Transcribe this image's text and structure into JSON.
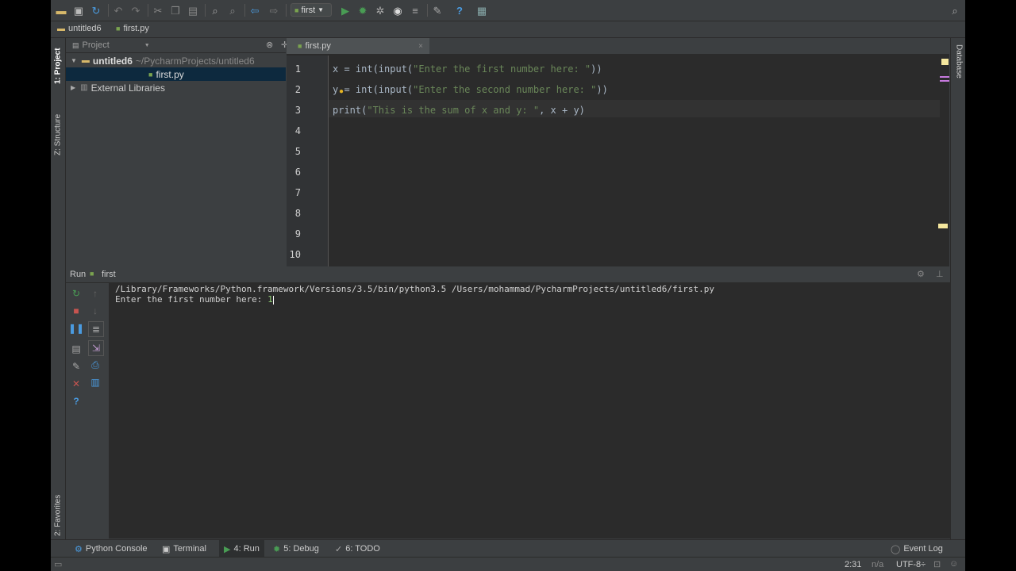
{
  "toolbar": {
    "run_config": "first",
    "icons": [
      "folder-open-icon",
      "save-icon",
      "sync-icon",
      "undo-icon",
      "redo-icon",
      "cut-icon",
      "copy-icon",
      "paste-icon",
      "find-icon",
      "replace-icon",
      "back-icon",
      "forward-icon",
      "run-icon",
      "debug-icon",
      "coverage-icon",
      "stop-icon",
      "vcs-icon",
      "tools-icon",
      "help-icon",
      "sdk-icon",
      "search-icon"
    ]
  },
  "breadcrumb": {
    "project": "untitled6",
    "file": "first.py"
  },
  "left_strip": {
    "project": "1: Project",
    "structure": "Z: Structure",
    "favorites": "2: Favorites"
  },
  "right_strip": {
    "database": "Database"
  },
  "project_panel": {
    "title": "Project",
    "root_name": "untitled6",
    "root_path": "~/PycharmProjects/untitled6",
    "file": "first.py",
    "ext_libs": "External Libraries"
  },
  "editor": {
    "tab_label": "first.py",
    "line_numbers": [
      "1",
      "2",
      "3",
      "4",
      "5",
      "6",
      "7",
      "8",
      "9",
      "10"
    ],
    "lines": [
      {
        "pre": "x = int(input(",
        "str": "\"Enter the first number here: \"",
        "post": "))"
      },
      {
        "pre": "y = int(input(",
        "str": "\"Enter the second number here: \"",
        "post": "))"
      },
      {
        "pre": "print(",
        "str": "\"This is the sum of x and y: \"",
        "post": ", x + y)"
      }
    ]
  },
  "run": {
    "label": "Run",
    "config": "first",
    "console_line1": "/Library/Frameworks/Python.framework/Versions/3.5/bin/python3.5 /Users/mohammad/PycharmProjects/untitled6/first.py",
    "console_line2": "Enter the first number here: ",
    "console_input": "1"
  },
  "tool_windows": [
    {
      "label": "Python Console"
    },
    {
      "label": "Terminal"
    },
    {
      "label": "4: Run"
    },
    {
      "label": "5: Debug"
    },
    {
      "label": "6: TODO"
    }
  ],
  "event_log": "Event Log",
  "status": {
    "position": "2:31",
    "line_sep": "n/a",
    "encoding": "UTF-8÷"
  },
  "colors": {
    "accent_selection": "#0d293e",
    "run_green": "#499c54",
    "stop_red": "#c75450",
    "string_green": "#6a8759"
  }
}
